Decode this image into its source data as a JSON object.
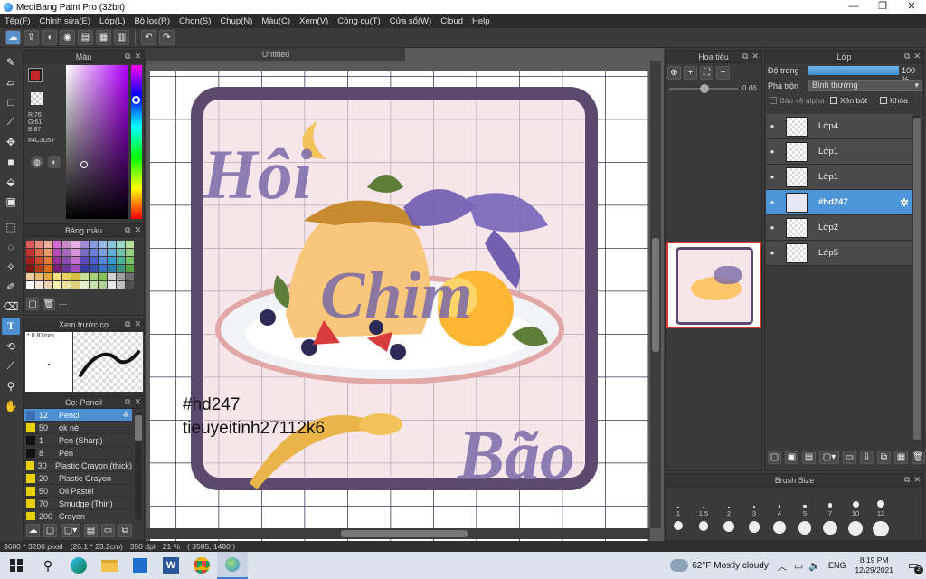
{
  "window": {
    "title": "MediBang Paint Pro (32bit)",
    "minimize": "—",
    "maximize": "❐",
    "close": "✕"
  },
  "menu": [
    "Tệp(F)",
    "Chỉnh sửa(E)",
    "Lớp(L)",
    "Bộ lọc(R)",
    "Chọn(S)",
    "Chụp(N)",
    "Màu(C)",
    "Xem(V)",
    "Công cụ(T)",
    "Cửa sổ(W)",
    "Cloud",
    "Help"
  ],
  "color_panel": {
    "title": "Màu",
    "r": "R:76",
    "g": "G:61",
    "b": "B:87",
    "hex": "#4C3D57"
  },
  "palette_panel": {
    "title": "Bảng màu",
    "more": "---"
  },
  "preview_panel": {
    "title": "Xem trước cọ",
    "size": "* 0.87mm"
  },
  "brush_panel": {
    "title": "Cọ: Pencil",
    "items": [
      {
        "size": "12",
        "name": "Pencil",
        "color": "#3a6fb0"
      },
      {
        "size": "50",
        "name": "ok nè",
        "color": "#e8d000"
      },
      {
        "size": "1",
        "name": "Pen (Sharp)",
        "color": "#111111"
      },
      {
        "size": "8",
        "name": "Pen",
        "color": "#111111"
      },
      {
        "size": "30",
        "name": "Plastic Crayon (thick)",
        "color": "#e8d000"
      },
      {
        "size": "20",
        "name": "Plastic Crayon",
        "color": "#e8d000"
      },
      {
        "size": "50",
        "name": "Oil Pastel",
        "color": "#e8d000"
      },
      {
        "size": "70",
        "name": "Smudge (Thin)",
        "color": "#e8d000"
      },
      {
        "size": "200",
        "name": "Crayon",
        "color": "#e8d000"
      }
    ]
  },
  "canvas": {
    "tab": "Untitled",
    "art_words": [
      "Hôi",
      "Chim",
      "Bão"
    ],
    "line1": "#hd247",
    "line2": "tieuyeitinh27112k6"
  },
  "navigator": {
    "title": "Hoa tiêu",
    "angle": "0 độ"
  },
  "layers": {
    "title": "Lớp",
    "opacity_label": "Độ trong",
    "opacity_value": "100 %",
    "opacity_fraction": 1.0,
    "blend_label": "Pha trộn",
    "blend_value": "Bình thường",
    "protect_alpha": "Bảo vệ alpha",
    "clip": "Xén bớt",
    "lock": "Khóa",
    "items": [
      {
        "name": "Lớp4",
        "selected": false
      },
      {
        "name": "Lớp1",
        "selected": false
      },
      {
        "name": "Lớp1",
        "selected": false
      },
      {
        "name": "#hd247",
        "selected": true
      },
      {
        "name": "Lớp2",
        "selected": false
      },
      {
        "name": "Lớp5",
        "selected": false
      }
    ]
  },
  "brush_size": {
    "title": "Brush Size",
    "sizes": [
      "1",
      "1.5",
      "2",
      "3",
      "4",
      "5",
      "7",
      "10",
      "12"
    ]
  },
  "status": {
    "dimensions": "3600 * 3200 pixel",
    "physical": "(26.1 * 23.2cm)",
    "dpi": "350 dpi",
    "zoom": "21 %",
    "coords": "( 3585, 1480 )"
  },
  "taskbar": {
    "weather": "62°F  Mostly cloudy",
    "lang": "ENG",
    "time": "8:19 PM",
    "date": "12/29/2021",
    "notif": "2"
  },
  "colors": {
    "accent": "#4d95d9",
    "current_color": "#4C3D57",
    "frame": "#5b4a6e",
    "art_purple": "#7a6aa8"
  }
}
